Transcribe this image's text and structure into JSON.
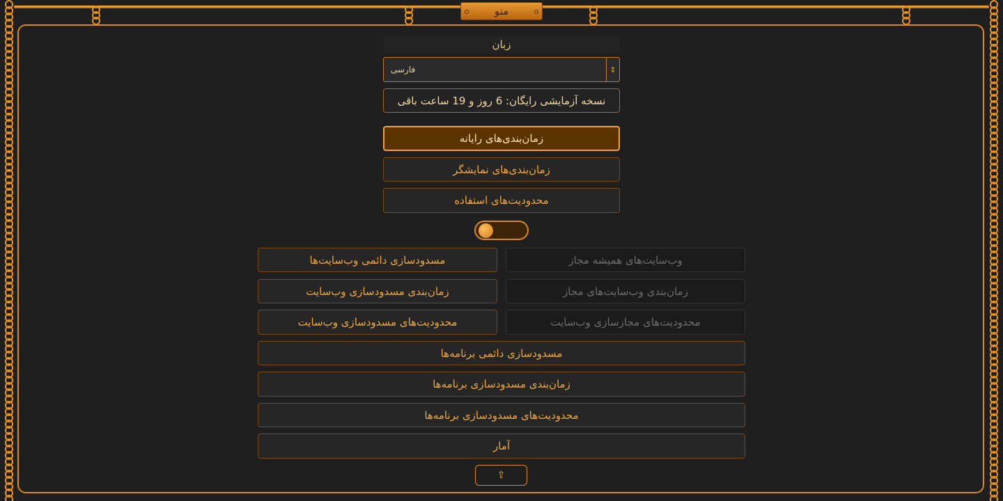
{
  "menu": {
    "title": "منو"
  },
  "language": {
    "title": "زبان",
    "selected": "فارسی",
    "arrow_icon": "updown-arrow-icon"
  },
  "trial": {
    "text": "نسخه آزمایشی رایگان: 6 روز و 19 ساعت باقی"
  },
  "main_buttons": [
    {
      "label": "زمان‌بندی‌های رایانه",
      "active": true
    },
    {
      "label": "زمان‌بندی‌های نمایشگر",
      "active": false
    },
    {
      "label": "محدودیت‌های استفاده",
      "active": false
    }
  ],
  "toggle": {
    "on": false
  },
  "websites": {
    "block": [
      "مسدودسازی دائمی وب‌سایت‌ها",
      "زمان‌بندی مسدودسازی وب‌سایت",
      "محدودیت‌های مسدودسازی وب‌سایت"
    ],
    "allow": [
      "وب‌سایت‌های همیشه مجاز",
      "زمان‌بندی وب‌سایت‌های مجاز",
      "محدودیت‌های مجازسازی وب‌سایت"
    ]
  },
  "apps": [
    "مسدودسازی دائمی برنامه‌ها",
    "زمان‌بندی مسدودسازی برنامه‌ها",
    "محدودیت‌های مسدودسازی برنامه‌ها",
    "آمار"
  ],
  "up_button": {
    "glyph": "⇧",
    "icon": "up-arrow-icon"
  },
  "colors": {
    "accent": "#f1a93b",
    "border": "#d98a1a",
    "active_bg": "#5a3300"
  }
}
